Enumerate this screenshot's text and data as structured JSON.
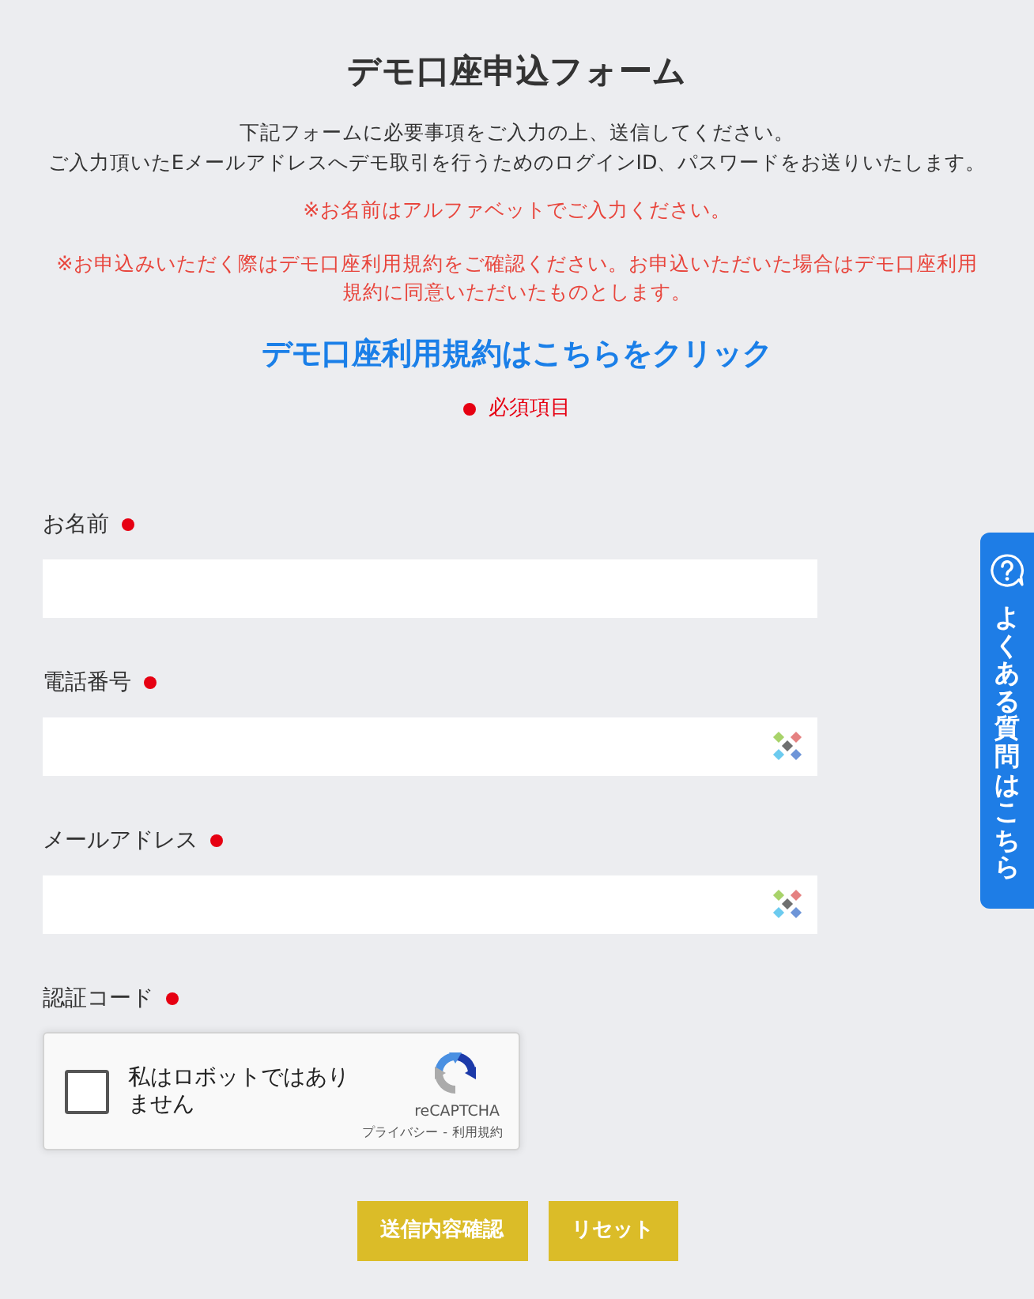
{
  "title": "デモ口座申込フォーム",
  "intro": [
    "下記フォームに必要事項をご入力の上、送信してください。",
    "ご入力頂いたEメールアドレスへデモ取引を行うためのログインID、パスワードをお送りいたします。"
  ],
  "notes": [
    "※お名前はアルファベットでご入力ください。",
    "※お申込みいただく際はデモ口座利用規約をご確認ください。お申込いただいた場合はデモ口座利用規約に同意いただいたものとします。"
  ],
  "terms_link": "デモ口座利用規約はこちらをクリック",
  "required_legend": {
    "label": "必須項目"
  },
  "fields": [
    {
      "label": "お名前",
      "required": true,
      "autofill_icon": false
    },
    {
      "label": "電話番号",
      "required": true,
      "autofill_icon": true
    },
    {
      "label": "メールアドレス",
      "required": true,
      "autofill_icon": true
    }
  ],
  "captcha": {
    "label": "認証コード",
    "required": true,
    "checkbox_label": "私はロボットではありません",
    "checked": false,
    "brand": "reCAPTCHA",
    "privacy": "プライバシー",
    "separator": "-",
    "terms": "利用規約"
  },
  "buttons": [
    "送信内容確認",
    "リセット"
  ],
  "faq_tab": {
    "label": "よくある質問はこちら"
  }
}
